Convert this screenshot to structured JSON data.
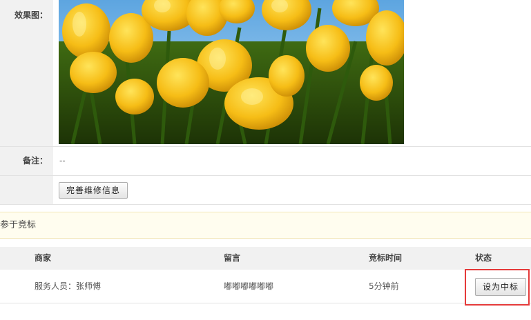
{
  "detail": {
    "effect_label": "效果图：",
    "note_label": "备注：",
    "note_value": "--",
    "complete_button": "完善维修信息"
  },
  "notice": {
    "text": "参于竞标"
  },
  "bids": {
    "headers": [
      "商家",
      "留言",
      "竞标时间",
      "状态"
    ],
    "rows": [
      {
        "merchant": "服务人员：张师傅",
        "message": "嘟嘟嘟嘟嘟嘟",
        "time": "5分钟前",
        "action": "设为中标"
      }
    ]
  },
  "colors": {
    "highlight": "#e53a3a",
    "notice_bg": "#fffdef",
    "label_bg": "#f1f1f1"
  }
}
